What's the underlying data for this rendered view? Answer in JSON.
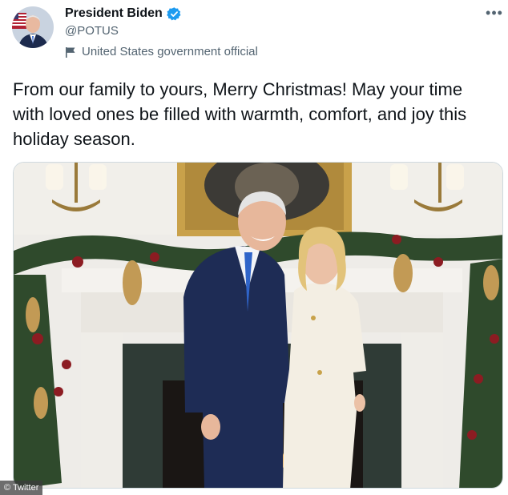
{
  "author": {
    "display_name": "President Biden",
    "handle": "@POTUS",
    "verified": true,
    "affiliation_label": "United States government official",
    "avatar_icon": "avatar-photo-icon"
  },
  "tweet": {
    "text": "From our family to yours, Merry Christmas! May your time with loved ones be filled with warmth, comfort, and joy this holiday season."
  },
  "menu": {
    "more_label": "•••"
  },
  "watermark": {
    "text": "© Twitter"
  },
  "colors": {
    "text_primary": "#0f1419",
    "text_secondary": "#536471",
    "verified_blue": "#1d9bf0",
    "border": "#cfd9de"
  }
}
